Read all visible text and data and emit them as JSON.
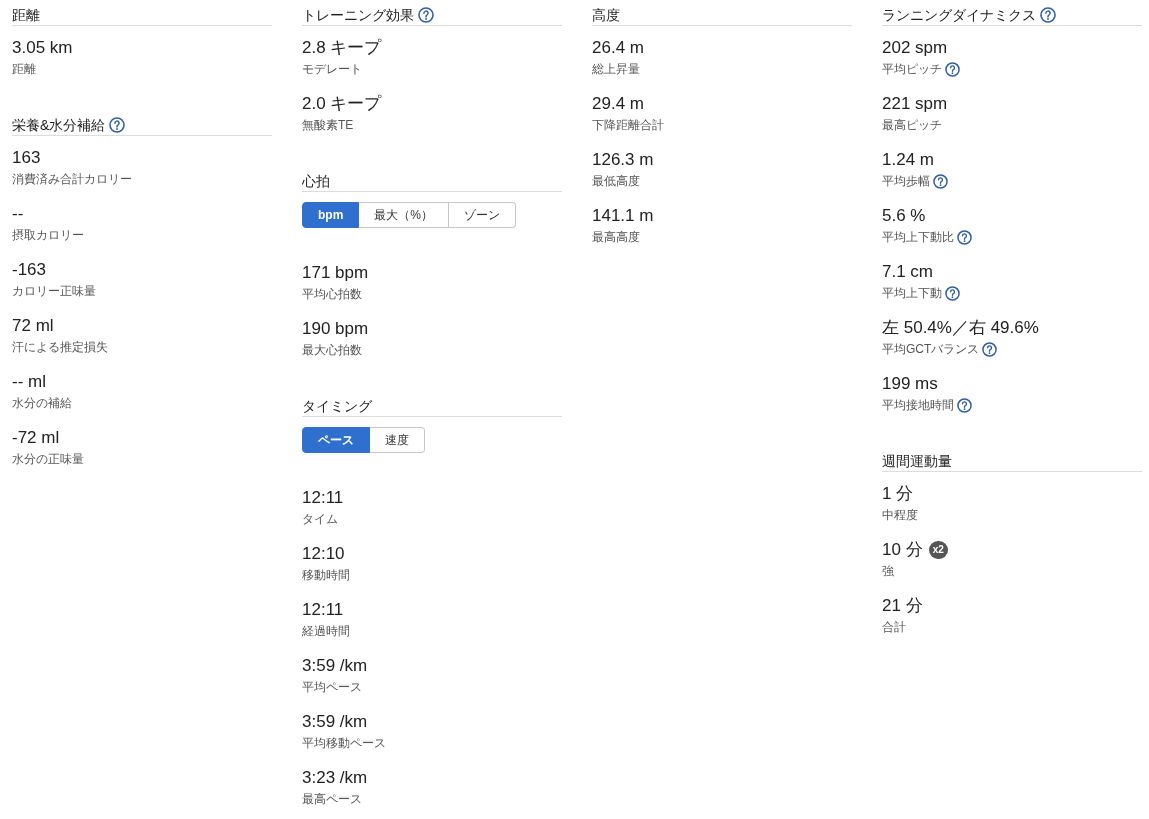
{
  "columns": [
    {
      "sections": [
        {
          "title": "距離",
          "help": false,
          "stats": [
            {
              "value": "3.05 km",
              "label": "距離",
              "help": false
            }
          ]
        },
        {
          "title": "栄養&水分補給",
          "help": true,
          "stats": [
            {
              "value": "163",
              "label": "消費済み合計カロリー",
              "help": false
            },
            {
              "value": "--",
              "label": "摂取カロリー",
              "help": false
            },
            {
              "value": "-163",
              "label": "カロリー正味量",
              "help": false
            },
            {
              "value": "72 ml",
              "label": "汗による推定損失",
              "help": false
            },
            {
              "value": "-- ml",
              "label": "水分の補給",
              "help": false
            },
            {
              "value": "-72 ml",
              "label": "水分の正味量",
              "help": false
            }
          ]
        }
      ]
    },
    {
      "sections": [
        {
          "title": "トレーニング効果",
          "help": true,
          "stats": [
            {
              "value": "2.8 キープ",
              "label": "モデレート",
              "help": false
            },
            {
              "value": "2.0 キープ",
              "label": "無酸素TE",
              "help": false
            }
          ]
        },
        {
          "title": "心拍",
          "help": false,
          "toggle": [
            {
              "label": "bpm",
              "selected": true
            },
            {
              "label": "最大（%）",
              "selected": false
            },
            {
              "label": "ゾーン",
              "selected": false
            }
          ],
          "stats": [
            {
              "value": "171 bpm",
              "label": "平均心拍数",
              "help": false
            },
            {
              "value": "190 bpm",
              "label": "最大心拍数",
              "help": false
            }
          ]
        },
        {
          "title": "タイミング",
          "help": false,
          "toggle": [
            {
              "label": "ペース",
              "selected": true
            },
            {
              "label": "速度",
              "selected": false
            }
          ],
          "stats": [
            {
              "value": "12:11",
              "label": "タイム",
              "help": false
            },
            {
              "value": "12:10",
              "label": "移動時間",
              "help": false
            },
            {
              "value": "12:11",
              "label": "経過時間",
              "help": false
            },
            {
              "value": "3:59 /km",
              "label": "平均ペース",
              "help": false
            },
            {
              "value": "3:59 /km",
              "label": "平均移動ペース",
              "help": false
            },
            {
              "value": "3:23 /km",
              "label": "最高ペース",
              "help": false
            }
          ]
        }
      ]
    },
    {
      "sections": [
        {
          "title": "高度",
          "help": false,
          "stats": [
            {
              "value": "26.4 m",
              "label": "総上昇量",
              "help": false
            },
            {
              "value": "29.4 m",
              "label": "下降距離合計",
              "help": false
            },
            {
              "value": "126.3 m",
              "label": "最低高度",
              "help": false
            },
            {
              "value": "141.1 m",
              "label": "最高高度",
              "help": false
            }
          ]
        }
      ]
    },
    {
      "sections": [
        {
          "title": "ランニングダイナミクス",
          "help": true,
          "stats": [
            {
              "value": "202 spm",
              "label": "平均ピッチ",
              "help": true
            },
            {
              "value": "221 spm",
              "label": "最高ピッチ",
              "help": false
            },
            {
              "value": "1.24 m",
              "label": "平均歩幅",
              "help": true
            },
            {
              "value": "5.6 %",
              "label": "平均上下動比",
              "help": true
            },
            {
              "value": "7.1 cm",
              "label": "平均上下動",
              "help": true
            },
            {
              "value": "左 50.4%／右 49.6%",
              "label": "平均GCTバランス",
              "help": true
            },
            {
              "value": "199 ms",
              "label": "平均接地時間",
              "help": true
            }
          ]
        },
        {
          "title": "週間運動量",
          "help": false,
          "stats": [
            {
              "value": "1 分",
              "label": "中程度",
              "help": false
            },
            {
              "value": "10 分",
              "label": "強",
              "help": false,
              "badge": "x2"
            },
            {
              "value": "21 分",
              "label": "合計",
              "help": false
            }
          ]
        }
      ]
    }
  ]
}
